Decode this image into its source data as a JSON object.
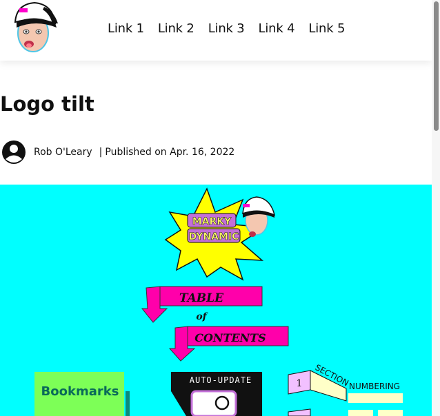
{
  "header": {
    "nav": [
      "Link 1",
      "Link 2",
      "Link 3",
      "Link 4",
      "Link 5"
    ]
  },
  "article": {
    "title": "Logo tilt",
    "author": "Rob O'Leary",
    "separator": "|",
    "published": "Published on Apr. 16, 2022"
  },
  "hero": {
    "badge_line1": "MARKY",
    "badge_line2": "DYNAMIC",
    "toc_line1": "TABLE",
    "toc_of": "of",
    "toc_line2": "CONTENTS",
    "bookmarks": "Bookmarks",
    "auto_update": "AUTO-UPDATE",
    "section": "SECTION",
    "numbering": "NUMBERING",
    "section_number": "1"
  },
  "colors": {
    "hero_bg": "#00ffff",
    "magenta": "#ff00aa",
    "star_yellow": "#ffff00",
    "bookmark_green": "#7dff57",
    "cream": "#ffffc8"
  }
}
